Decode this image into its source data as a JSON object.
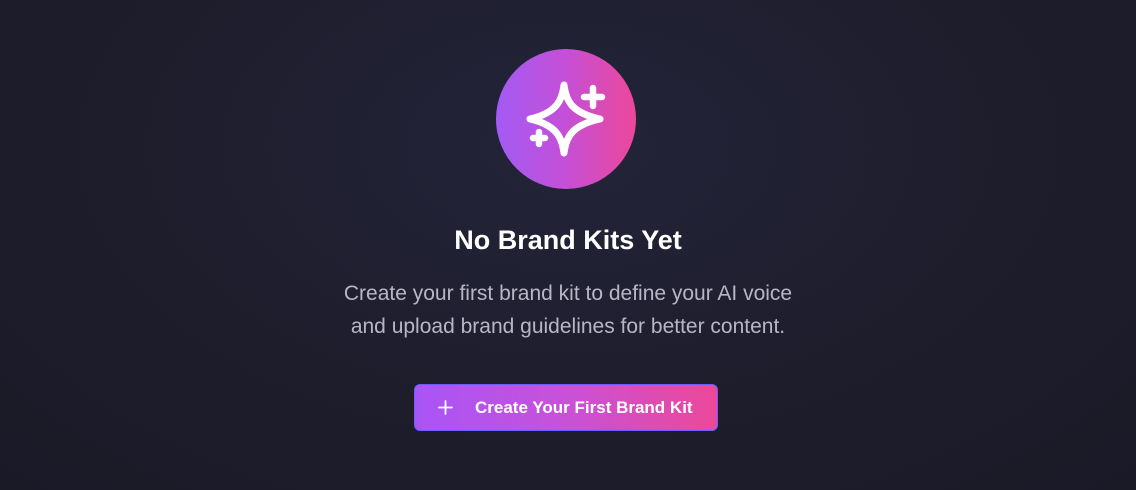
{
  "empty_state": {
    "icon": "sparkles-icon",
    "title": "No Brand Kits Yet",
    "description_lines": [
      "Create your first brand kit to define your AI voice",
      "and upload brand guidelines for better content."
    ],
    "button": {
      "icon": "plus-icon",
      "label": "Create Your First Brand Kit"
    }
  },
  "colors": {
    "background": "#1d1d2c",
    "accent_start": "#a855f7",
    "accent_end": "#ec4899",
    "title_text": "#ffffff",
    "body_text": "#b7b7c4"
  }
}
